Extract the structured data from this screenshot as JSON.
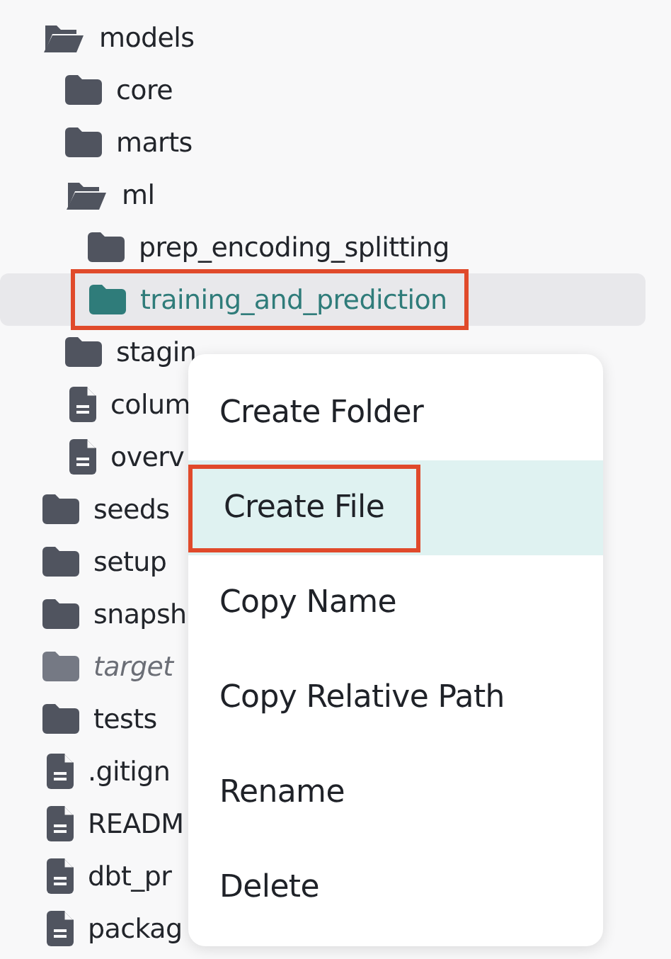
{
  "tree": [
    {
      "name": "models",
      "kind": "folder",
      "expanded": true,
      "children": [
        {
          "name": "core",
          "kind": "folder",
          "expanded": false
        },
        {
          "name": "marts",
          "kind": "folder",
          "expanded": false
        },
        {
          "name": "ml",
          "kind": "folder",
          "expanded": true,
          "children": [
            {
              "name": "prep_encoding_splitting",
              "kind": "folder",
              "expanded": false,
              "selected": false,
              "annotated": false
            },
            {
              "name": "training_and_prediction",
              "kind": "folder",
              "expanded": false,
              "selected": true,
              "annotated": true
            }
          ]
        },
        {
          "name": "stagin",
          "kind": "folder",
          "expanded": false
        },
        {
          "name": "colum",
          "kind": "file"
        },
        {
          "name": "overv",
          "kind": "file"
        }
      ]
    },
    {
      "name": "seeds",
      "kind": "folder",
      "expanded": false
    },
    {
      "name": "setup",
      "kind": "folder",
      "expanded": false
    },
    {
      "name": "snapsh",
      "kind": "folder",
      "expanded": false
    },
    {
      "name": "target",
      "kind": "folder",
      "expanded": false,
      "ignored": true
    },
    {
      "name": "tests",
      "kind": "folder",
      "expanded": false
    },
    {
      "name": ".gitign",
      "kind": "file"
    },
    {
      "name": "READM",
      "kind": "file"
    },
    {
      "name": "dbt_pr",
      "kind": "file"
    },
    {
      "name": "packag",
      "kind": "file"
    }
  ],
  "context_menu": [
    {
      "label": "Create Folder",
      "hovered": false,
      "annotated": false
    },
    {
      "label": "Create File",
      "hovered": true,
      "annotated": true
    },
    {
      "label": "Copy Name",
      "hovered": false,
      "annotated": false
    },
    {
      "label": "Copy Relative Path",
      "hovered": false,
      "annotated": false
    },
    {
      "label": "Rename",
      "hovered": false,
      "annotated": false
    },
    {
      "label": "Delete",
      "hovered": false,
      "annotated": false
    }
  ]
}
